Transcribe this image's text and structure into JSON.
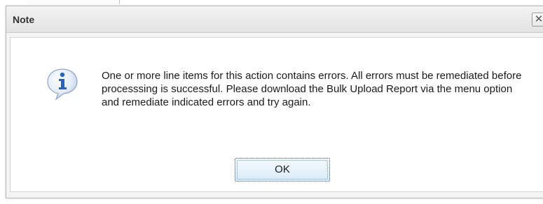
{
  "dialog": {
    "title": "Note",
    "close_glyph": "✕",
    "icon": "info-icon",
    "message": "One or more line items for this action contains errors. All errors must be remediated before processsing is successful. Please download the Bulk Upload Report via the menu option and remediate indicated errors and try again.",
    "ok_label": "OK"
  },
  "colors": {
    "titlebar": "#e8e8e8",
    "ok_button": "#d7eaf8",
    "info_icon": "#2a62b8"
  }
}
